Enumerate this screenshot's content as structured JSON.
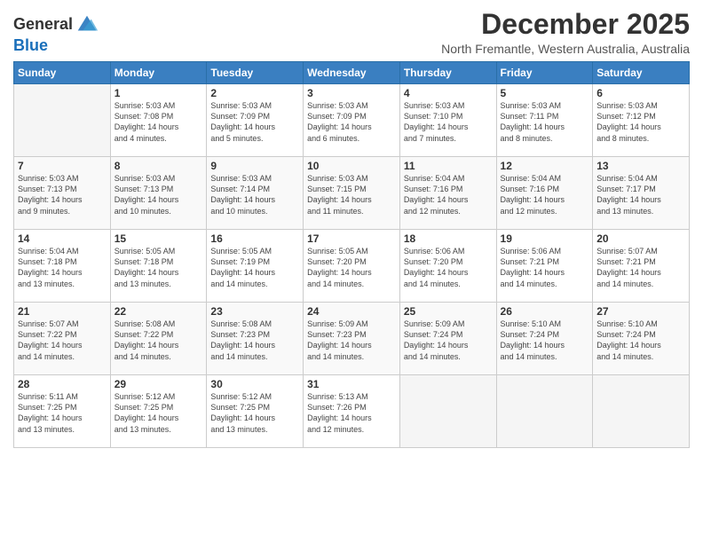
{
  "header": {
    "logo_general": "General",
    "logo_blue": "Blue",
    "month_title": "December 2025",
    "location": "North Fremantle, Western Australia, Australia"
  },
  "calendar": {
    "days_of_week": [
      "Sunday",
      "Monday",
      "Tuesday",
      "Wednesday",
      "Thursday",
      "Friday",
      "Saturday"
    ],
    "weeks": [
      [
        {
          "day": "",
          "info": ""
        },
        {
          "day": "1",
          "info": "Sunrise: 5:03 AM\nSunset: 7:08 PM\nDaylight: 14 hours\nand 4 minutes."
        },
        {
          "day": "2",
          "info": "Sunrise: 5:03 AM\nSunset: 7:09 PM\nDaylight: 14 hours\nand 5 minutes."
        },
        {
          "day": "3",
          "info": "Sunrise: 5:03 AM\nSunset: 7:09 PM\nDaylight: 14 hours\nand 6 minutes."
        },
        {
          "day": "4",
          "info": "Sunrise: 5:03 AM\nSunset: 7:10 PM\nDaylight: 14 hours\nand 7 minutes."
        },
        {
          "day": "5",
          "info": "Sunrise: 5:03 AM\nSunset: 7:11 PM\nDaylight: 14 hours\nand 8 minutes."
        },
        {
          "day": "6",
          "info": "Sunrise: 5:03 AM\nSunset: 7:12 PM\nDaylight: 14 hours\nand 8 minutes."
        }
      ],
      [
        {
          "day": "7",
          "info": "Sunrise: 5:03 AM\nSunset: 7:13 PM\nDaylight: 14 hours\nand 9 minutes."
        },
        {
          "day": "8",
          "info": "Sunrise: 5:03 AM\nSunset: 7:13 PM\nDaylight: 14 hours\nand 10 minutes."
        },
        {
          "day": "9",
          "info": "Sunrise: 5:03 AM\nSunset: 7:14 PM\nDaylight: 14 hours\nand 10 minutes."
        },
        {
          "day": "10",
          "info": "Sunrise: 5:03 AM\nSunset: 7:15 PM\nDaylight: 14 hours\nand 11 minutes."
        },
        {
          "day": "11",
          "info": "Sunrise: 5:04 AM\nSunset: 7:16 PM\nDaylight: 14 hours\nand 12 minutes."
        },
        {
          "day": "12",
          "info": "Sunrise: 5:04 AM\nSunset: 7:16 PM\nDaylight: 14 hours\nand 12 minutes."
        },
        {
          "day": "13",
          "info": "Sunrise: 5:04 AM\nSunset: 7:17 PM\nDaylight: 14 hours\nand 13 minutes."
        }
      ],
      [
        {
          "day": "14",
          "info": "Sunrise: 5:04 AM\nSunset: 7:18 PM\nDaylight: 14 hours\nand 13 minutes."
        },
        {
          "day": "15",
          "info": "Sunrise: 5:05 AM\nSunset: 7:18 PM\nDaylight: 14 hours\nand 13 minutes."
        },
        {
          "day": "16",
          "info": "Sunrise: 5:05 AM\nSunset: 7:19 PM\nDaylight: 14 hours\nand 14 minutes."
        },
        {
          "day": "17",
          "info": "Sunrise: 5:05 AM\nSunset: 7:20 PM\nDaylight: 14 hours\nand 14 minutes."
        },
        {
          "day": "18",
          "info": "Sunrise: 5:06 AM\nSunset: 7:20 PM\nDaylight: 14 hours\nand 14 minutes."
        },
        {
          "day": "19",
          "info": "Sunrise: 5:06 AM\nSunset: 7:21 PM\nDaylight: 14 hours\nand 14 minutes."
        },
        {
          "day": "20",
          "info": "Sunrise: 5:07 AM\nSunset: 7:21 PM\nDaylight: 14 hours\nand 14 minutes."
        }
      ],
      [
        {
          "day": "21",
          "info": "Sunrise: 5:07 AM\nSunset: 7:22 PM\nDaylight: 14 hours\nand 14 minutes."
        },
        {
          "day": "22",
          "info": "Sunrise: 5:08 AM\nSunset: 7:22 PM\nDaylight: 14 hours\nand 14 minutes."
        },
        {
          "day": "23",
          "info": "Sunrise: 5:08 AM\nSunset: 7:23 PM\nDaylight: 14 hours\nand 14 minutes."
        },
        {
          "day": "24",
          "info": "Sunrise: 5:09 AM\nSunset: 7:23 PM\nDaylight: 14 hours\nand 14 minutes."
        },
        {
          "day": "25",
          "info": "Sunrise: 5:09 AM\nSunset: 7:24 PM\nDaylight: 14 hours\nand 14 minutes."
        },
        {
          "day": "26",
          "info": "Sunrise: 5:10 AM\nSunset: 7:24 PM\nDaylight: 14 hours\nand 14 minutes."
        },
        {
          "day": "27",
          "info": "Sunrise: 5:10 AM\nSunset: 7:24 PM\nDaylight: 14 hours\nand 14 minutes."
        }
      ],
      [
        {
          "day": "28",
          "info": "Sunrise: 5:11 AM\nSunset: 7:25 PM\nDaylight: 14 hours\nand 13 minutes."
        },
        {
          "day": "29",
          "info": "Sunrise: 5:12 AM\nSunset: 7:25 PM\nDaylight: 14 hours\nand 13 minutes."
        },
        {
          "day": "30",
          "info": "Sunrise: 5:12 AM\nSunset: 7:25 PM\nDaylight: 14 hours\nand 13 minutes."
        },
        {
          "day": "31",
          "info": "Sunrise: 5:13 AM\nSunset: 7:26 PM\nDaylight: 14 hours\nand 12 minutes."
        },
        {
          "day": "",
          "info": ""
        },
        {
          "day": "",
          "info": ""
        },
        {
          "day": "",
          "info": ""
        }
      ]
    ]
  }
}
